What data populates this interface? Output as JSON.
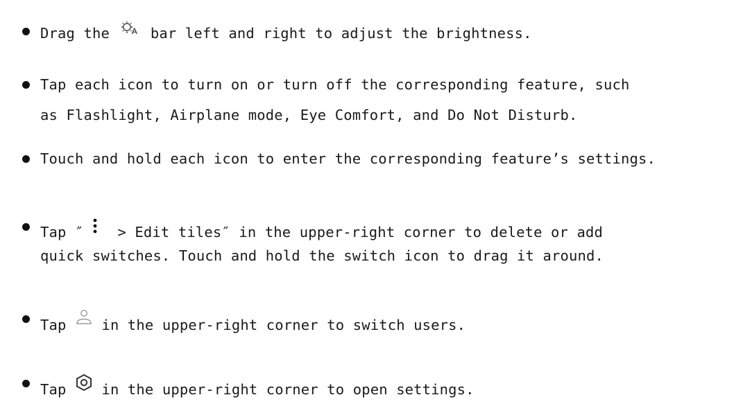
{
  "bullets": [
    {
      "before_icon": "Drag the ",
      "icon": "brightness-auto-icon",
      "after_icon": " bar left and right to adjust the brightness."
    },
    {
      "line1": "Tap each icon to turn on or turn off the corresponding feature, such",
      "line2": "as Flashlight, Airplane mode, Eye Comfort, and Do Not Disturb."
    },
    {
      "text": "Touch and hold each icon to enter the corresponding feature’s settings."
    },
    {
      "before_icon": "Tap ″",
      "icon": "more-vertical-icon",
      "after_icon": "  > Edit tiles″ in the upper-right corner to delete or add",
      "line2": "quick switches. Touch and hold the switch icon to drag it around."
    },
    {
      "before_icon": "Tap ",
      "icon": "user-icon",
      "after_icon": " in the upper-right corner to switch users."
    },
    {
      "before_icon": "Tap ",
      "icon": "settings-icon",
      "after_icon": " in the upper-right corner to open settings."
    }
  ],
  "colors": {
    "text": "#1a1a1a",
    "icon_dark": "#555555",
    "icon_light": "#9a9a9a"
  }
}
